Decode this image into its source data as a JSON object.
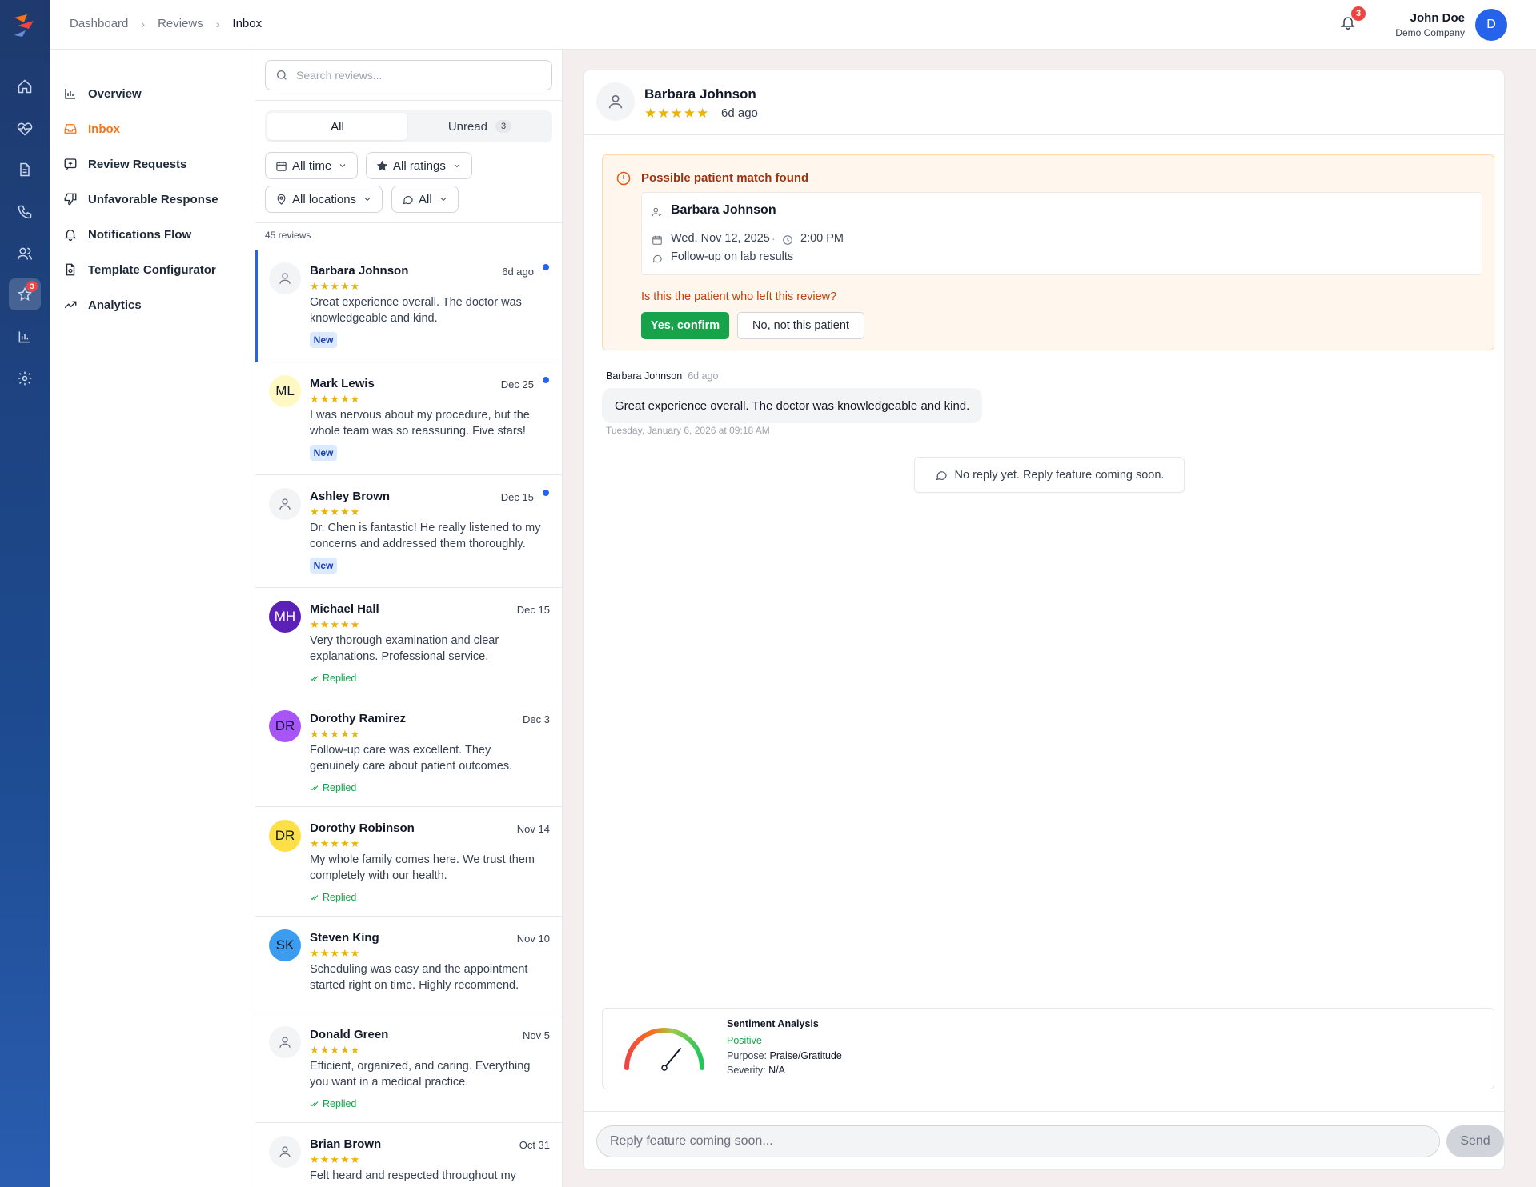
{
  "breadcrumb": [
    "Dashboard",
    "Reviews",
    "Inbox"
  ],
  "notifications": {
    "count": "3"
  },
  "user": {
    "name": "John Doe",
    "company": "Demo Company",
    "initial": "D"
  },
  "rail": {
    "reviews_badge": "3"
  },
  "nav": [
    {
      "label": "Overview",
      "icon": "bar-chart-icon"
    },
    {
      "label": "Inbox",
      "icon": "inbox-icon",
      "active": true
    },
    {
      "label": "Review Requests",
      "icon": "add-request-icon"
    },
    {
      "label": "Unfavorable Response",
      "icon": "thumbs-down-icon"
    },
    {
      "label": "Notifications Flow",
      "icon": "bell-icon"
    },
    {
      "label": "Template Configurator",
      "icon": "document-config-icon"
    },
    {
      "label": "Analytics",
      "icon": "trending-up-icon"
    }
  ],
  "list": {
    "search_placeholder": "Search reviews...",
    "tab_all": "All",
    "tab_unread": "Unread",
    "unread_count": "3",
    "filters": {
      "time": "All time",
      "ratings": "All ratings",
      "locations": "All locations",
      "channel": "All"
    },
    "count_label": "45 reviews",
    "new_label": "New",
    "replied_label": "Replied",
    "reviews": [
      {
        "name": "Barbara Johnson",
        "date": "6d ago",
        "stars": "★★★★★",
        "text": "Great experience overall. The doctor was knowledgeable and kind.",
        "initials": "",
        "status": "new",
        "unread": true
      },
      {
        "name": "Mark Lewis",
        "date": "Dec 25",
        "stars": "★★★★★",
        "text": "I was nervous about my procedure, but the whole team was so reassuring. Five stars!",
        "initials": "ML",
        "status": "new",
        "unread": true
      },
      {
        "name": "Ashley Brown",
        "date": "Dec 15",
        "stars": "★★★★★",
        "text": "Dr. Chen is fantastic! He really listened to my concerns and addressed them thoroughly.",
        "initials": "",
        "status": "new",
        "unread": true
      },
      {
        "name": "Michael Hall",
        "date": "Dec 15",
        "stars": "★★★★★",
        "text": "Very thorough examination and clear explanations. Professional service.",
        "initials": "MH",
        "status": "replied"
      },
      {
        "name": "Dorothy Ramirez",
        "date": "Dec 3",
        "stars": "★★★★★",
        "text": "Follow-up care was excellent. They genuinely care about patient outcomes.",
        "initials": "DR",
        "status": "replied"
      },
      {
        "name": "Dorothy Robinson",
        "date": "Nov 14",
        "stars": "★★★★★",
        "text": "My whole family comes here. We trust them completely with our health.",
        "initials": "DR",
        "status": "replied"
      },
      {
        "name": "Steven King",
        "date": "Nov 10",
        "stars": "★★★★★",
        "text": "Scheduling was easy and the appointment started right on time. Highly recommend.",
        "initials": "SK",
        "status": ""
      },
      {
        "name": "Donald Green",
        "date": "Nov 5",
        "stars": "★★★★★",
        "text": "Efficient, organized, and caring. Everything you want in a medical practice.",
        "initials": "",
        "status": "replied"
      },
      {
        "name": "Brian Brown",
        "date": "Oct 31",
        "stars": "★★★★★",
        "text": "Felt heard and respected throughout my",
        "initials": "",
        "status": ""
      }
    ]
  },
  "detail": {
    "name": "Barbara Johnson",
    "stars": "★★★★★",
    "ago": "6d ago",
    "match": {
      "title": "Possible patient match found",
      "patient_name": "Barbara Johnson",
      "date": "Wed, Nov 12, 2025",
      "time": "2:00 PM",
      "reason": "Follow-up on lab results",
      "question": "Is this the patient who left this review?",
      "confirm": "Yes, confirm",
      "reject": "No, not this patient"
    },
    "message": {
      "author": "Barbara Johnson",
      "ago": "6d ago",
      "text": "Great experience overall. The doctor was knowledgeable and kind.",
      "timestamp": "Tuesday, January 6, 2026 at 09:18 AM"
    },
    "no_reply": "No reply yet. Reply feature coming soon.",
    "sentiment": {
      "title": "Sentiment Analysis",
      "label": "Positive",
      "purpose_label": "Purpose:",
      "purpose": "Praise/Gratitude",
      "severity_label": "Severity:",
      "severity": "N/A"
    },
    "reply_placeholder": "Reply feature coming soon...",
    "send": "Send"
  },
  "colors": {
    "accent": "#2563eb",
    "nav_active": "#f97316",
    "star": "#eab308",
    "success": "#16a34a"
  }
}
